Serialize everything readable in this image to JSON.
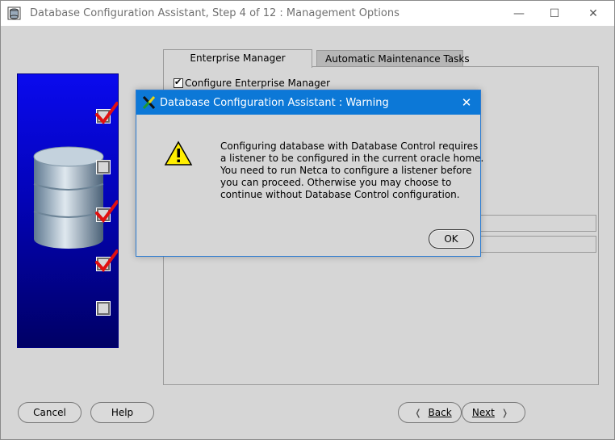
{
  "window": {
    "title": "Database Configuration Assistant, Step 4 of 12 : Management Options",
    "controls": {
      "minimize": "—",
      "maximize": "☐",
      "close": "✕"
    }
  },
  "tabs": [
    {
      "label": "Enterprise Manager",
      "active": true
    },
    {
      "label": "Automatic Maintenance Tasks",
      "active": false
    }
  ],
  "enterprise_manager": {
    "configure_label": "Configure Enterprise Manager",
    "configure_checked": true
  },
  "steps": [
    {
      "checked": true
    },
    {
      "checked": false
    },
    {
      "checked": true
    },
    {
      "checked": true
    },
    {
      "checked": false
    }
  ],
  "buttons": {
    "cancel": "Cancel",
    "help": "Help",
    "back": "Back",
    "next": "Next"
  },
  "dialog": {
    "title": "Database Configuration Assistant : Warning",
    "message_lines": [
      "Configuring database with Database Control requires",
      "a listener to be configured in the current oracle home.",
      "You need to run Netca to configure a listener before",
      "you can proceed. Otherwise you may choose to",
      "continue without Database Control configuration."
    ],
    "ok_label": "OK",
    "close_glyph": "✕"
  },
  "colors": {
    "dialog_titlebar": "#0c78d7",
    "panel_blue": "#0303b8",
    "check_red": "#e01010",
    "warning_yellow": "#ffee00"
  }
}
